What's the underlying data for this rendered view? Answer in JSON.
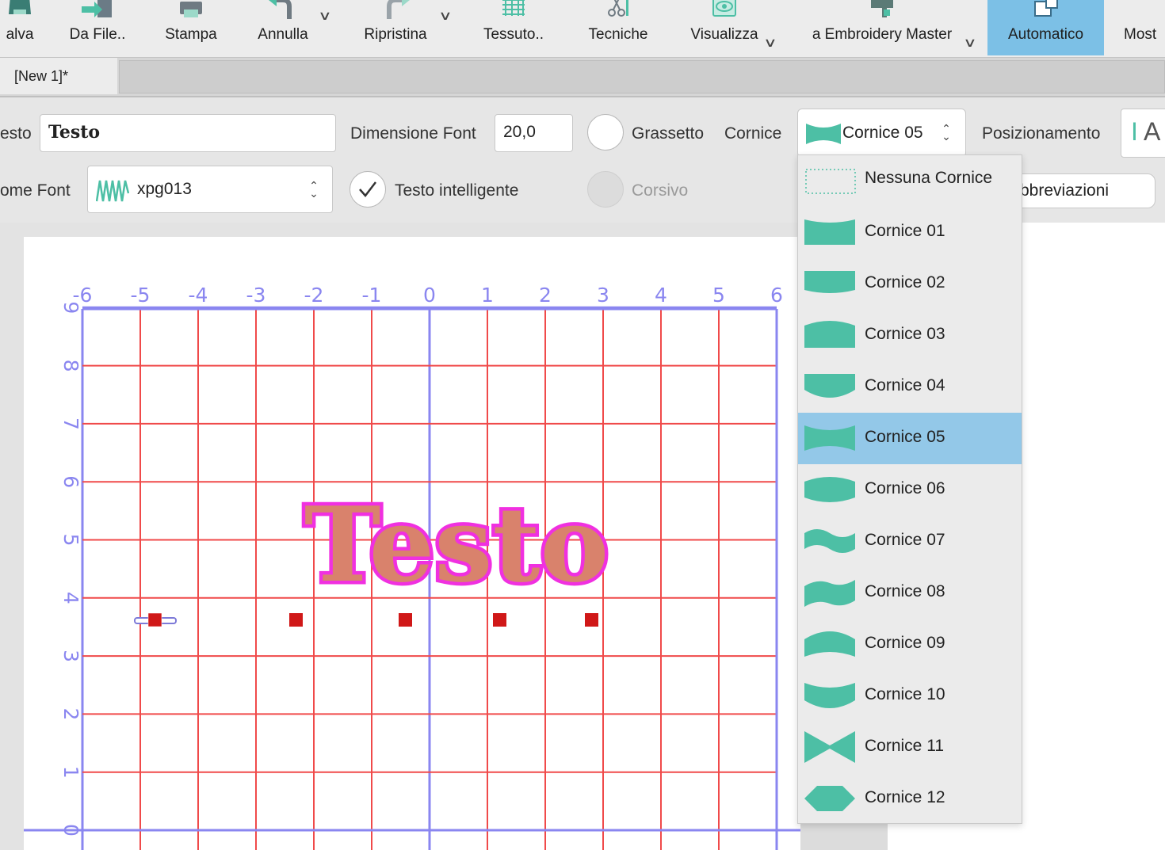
{
  "toolbar": {
    "items": [
      {
        "label": "alva",
        "icon": "save-icon"
      },
      {
        "label": "Da File..",
        "icon": "import-file-icon"
      },
      {
        "label": "Stampa",
        "icon": "print-icon"
      },
      {
        "label": "Annulla",
        "icon": "undo-icon"
      },
      {
        "label": "Ripristina",
        "icon": "redo-icon"
      },
      {
        "label": "Tessuto..",
        "icon": "fabric-icon"
      },
      {
        "label": "Tecniche",
        "icon": "scissors-icon"
      },
      {
        "label": "Visualizza",
        "icon": "eye-icon"
      },
      {
        "label": "a Embroidery Master",
        "icon": "sewing-machine-icon"
      },
      {
        "label": "Automatico",
        "icon": "automatic-icon",
        "active": true
      },
      {
        "label": "Most",
        "icon": "show-icon"
      }
    ]
  },
  "tabs": {
    "document": "[New 1]*"
  },
  "properties": {
    "text_label": "esto",
    "text_value": "Testo",
    "font_size_label": "Dimensione Font",
    "font_size_value": "20,0",
    "bold_label": "Grassetto",
    "frame_label": "Cornice",
    "frame_value": "Cornice 05",
    "positioning_label": "Posizionamento",
    "font_name_label": "ome Font",
    "font_name_value": "xpg013",
    "smart_text_label": "Testo intelligente",
    "smart_text_checked": true,
    "italic_label": "Corsivo",
    "abbreviations_label": "bbreviazioni"
  },
  "frame_dropdown": {
    "selected": "Cornice 05",
    "options": [
      "Nessuna Cornice",
      "Cornice 01",
      "Cornice 02",
      "Cornice 03",
      "Cornice 04",
      "Cornice 05",
      "Cornice 06",
      "Cornice 07",
      "Cornice 08",
      "Cornice 09",
      "Cornice 10",
      "Cornice 11",
      "Cornice 12"
    ]
  },
  "canvas": {
    "x_ticks": [
      "-6",
      "-5",
      "-4",
      "-3",
      "-2",
      "-1",
      "0",
      "1",
      "2",
      "3",
      "4",
      "5",
      "6"
    ],
    "y_ticks": [
      "0",
      "1",
      "2",
      "3",
      "4",
      "5",
      "6",
      "7",
      "8",
      "9"
    ],
    "design_text": "Testo"
  },
  "colors": {
    "accent_teal": "#4dbfa5",
    "selection_blue": "#93c8e8",
    "grid_red": "#f04a4a",
    "axis_blue": "#8a86f0",
    "outline_magenta": "#f030e0",
    "fill_salmon": "#d9826c"
  }
}
